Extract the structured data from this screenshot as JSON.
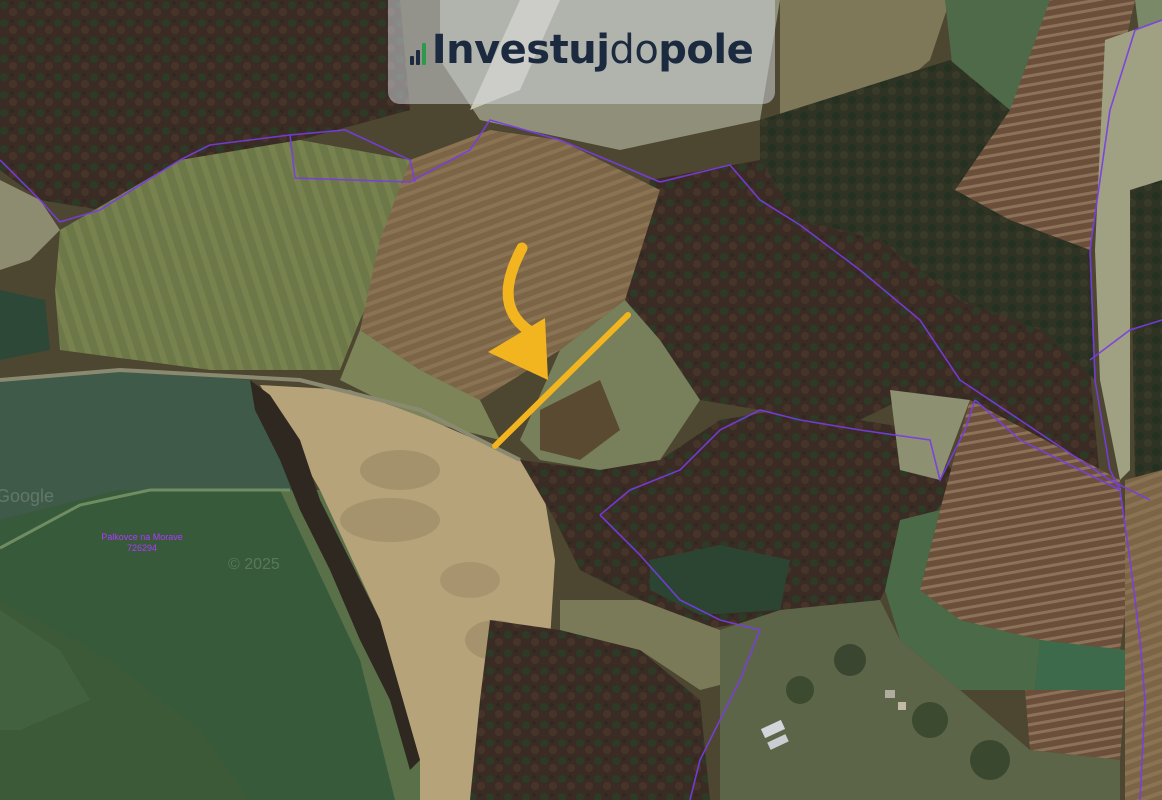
{
  "map": {
    "type": "satellite-cadastral",
    "boundary_color": "#7a3ce6",
    "highlight_color": "#f2b41f"
  },
  "logo": {
    "part1": "Investuj",
    "part2": "do",
    "part3": "pole",
    "icon": "bar-chart-icon"
  },
  "parcel_label": {
    "line1": "Palkovce na Morave",
    "line2": "726294"
  },
  "watermarks": {
    "google": "Google",
    "copyright": "© 2025"
  },
  "arrow": {
    "icon": "curved-arrow-down-icon"
  }
}
